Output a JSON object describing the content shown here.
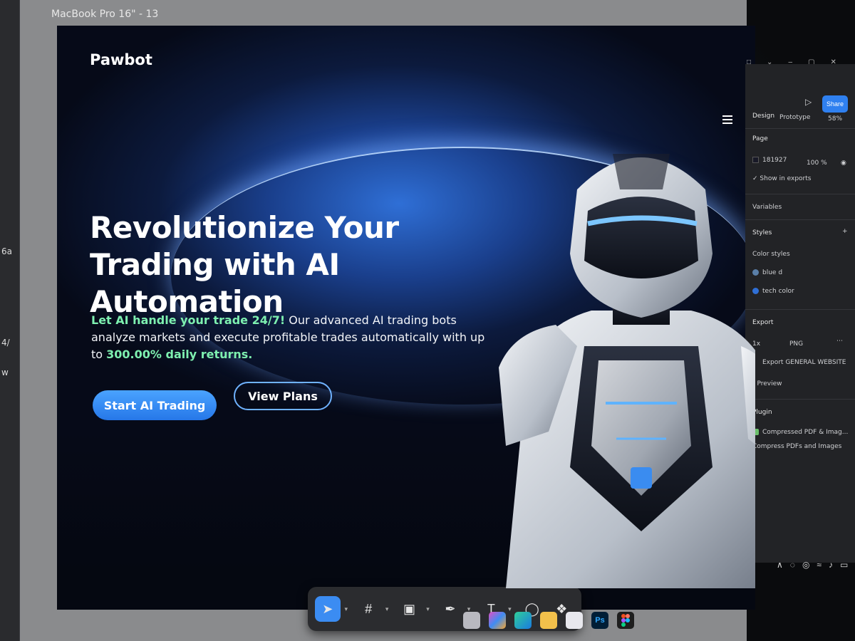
{
  "left_strip": {
    "fragments": [
      "6a",
      "4/",
      "w"
    ]
  },
  "frame": {
    "label": "MacBook Pro 16\" - 13"
  },
  "landing": {
    "brand": "Pawbot",
    "hero_title_line1": "Revolutionize Your",
    "hero_title_line2": "Trading with AI Automation",
    "sub_highlight1": "Let AI handle your trade 24/7!",
    "sub_text1": " Our advanced AI trading bots analyze markets and execute profitable trades automatically with up to ",
    "sub_highlight2": "300.00% daily returns.",
    "cta_primary": "Start AI Trading",
    "cta_secondary": "View Plans",
    "menu_icon": "hamburger-icon"
  },
  "toolbar": {
    "tools": [
      "move-icon",
      "frame-icon",
      "image-icon",
      "pen-icon",
      "text-icon",
      "comment-icon",
      "components-icon"
    ],
    "text_tool_glyph": "T",
    "mode_tools": [
      "draw-mode-icon",
      "design-mode-icon",
      "dev-mode-icon"
    ]
  },
  "panel": {
    "tab_design": "Design",
    "tab_prototype": "Prototype",
    "zoom": "58%",
    "share_label": "Share",
    "page_heading": "Page",
    "page_color": "181927",
    "page_opacity": "100",
    "page_opacity_unit": "%",
    "show_in_exports": "Show in exports",
    "variables": "Variables",
    "styles": "Styles",
    "color_styles": "Color styles",
    "style1": "blue d",
    "style2": "tech color",
    "export_heading": "Export",
    "export_scale": "1x",
    "export_format": "PNG",
    "export_button": "Export GENERAL WEBSITE",
    "preview": "Preview",
    "plugin_heading": "Plugin",
    "plugin_name": "Compressed PDF & Imag...",
    "plugin_desc": "Compress PDFs and Images"
  },
  "taskbar": {
    "apps": [
      "file-explorer-icon",
      "copilot-icon",
      "edge-icon",
      "folder-icon",
      "store-icon",
      "photoshop-icon",
      "figma-icon"
    ],
    "ps_label": "Ps"
  },
  "colors": {
    "accent": "#2f80f0",
    "highlight_green": "#7ef0b0",
    "outline_blue": "#6fb2ff"
  }
}
